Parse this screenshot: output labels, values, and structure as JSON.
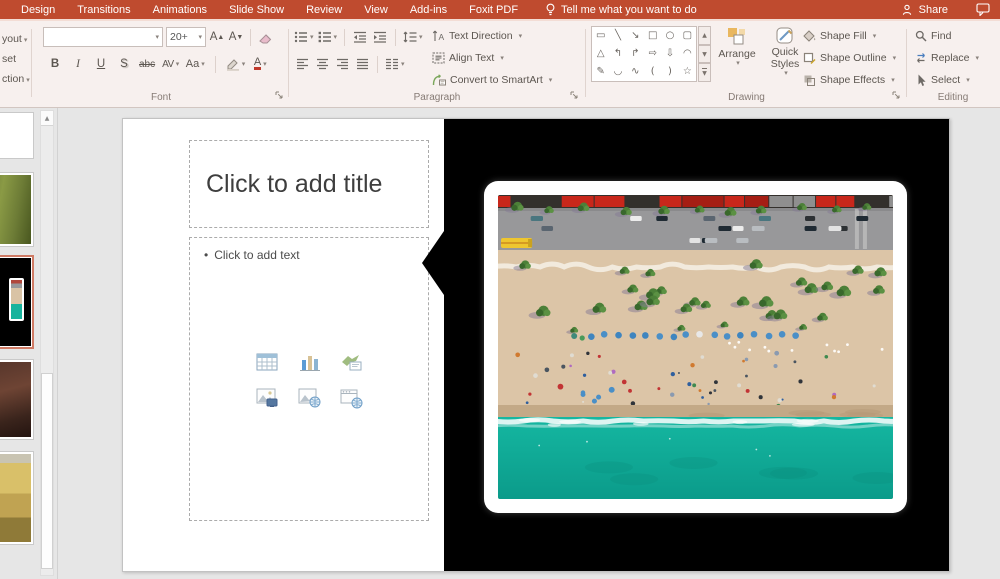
{
  "colors": {
    "accent_red": "#bf4b2f",
    "ribbon_bg": "#f7f0ee",
    "workspace_bg": "#e6e6e6",
    "selected_thumbnail_border": "#cf7a64",
    "arrange_orange": "#e9b75f"
  },
  "tab_bar": {
    "tabs": [
      "Design",
      "Transitions",
      "Animations",
      "Slide Show",
      "Review",
      "View",
      "Add-ins",
      "Foxit PDF"
    ],
    "tell_me_label": "Tell me what you want to do",
    "share_label": "Share"
  },
  "ribbon": {
    "slides_group_cut": {
      "layout_partial": "yout",
      "reset_partial": "set",
      "section_partial": "ction"
    },
    "font_group": {
      "label": "Font",
      "font_name_value": "",
      "font_size_value": "20+",
      "bold": "B",
      "italic": "I",
      "underline": "U",
      "shadow": "S",
      "strikethrough": "abc",
      "char_spacing": "AV",
      "change_case": "Aa",
      "font_color": "A"
    },
    "paragraph_group": {
      "label": "Paragraph",
      "text_direction_label": "Text Direction",
      "align_text_label": "Align Text",
      "convert_smartart_label": "Convert to SmartArt"
    },
    "drawing_group": {
      "label": "Drawing",
      "arrange_label": "Arrange",
      "quick_styles_label": "Quick Styles",
      "shape_fill_label": "Shape Fill",
      "shape_outline_label": "Shape Outline",
      "shape_effects_label": "Shape Effects",
      "shape_gallery_rows": [
        [
          "▭",
          "╲",
          "↘",
          "□",
          "○",
          "▢"
        ],
        [
          "△",
          "↰",
          "↱",
          "⇨",
          "⇩",
          "◠"
        ],
        [
          "✎",
          "◡",
          "∿",
          "(",
          ")",
          "☆"
        ]
      ]
    },
    "editing_group": {
      "label": "Editing",
      "find_label": "Find",
      "replace_label": "Replace",
      "select_label": "Select"
    }
  },
  "slide": {
    "title_placeholder": "Click to add title",
    "body_placeholder": "Click to add text",
    "bullet_char": "•",
    "content_icons": [
      "insert-table",
      "insert-chart",
      "insert-smartart",
      "insert-pictures",
      "insert-online-pictures",
      "insert-video"
    ]
  },
  "thumbnail_panel": {
    "slides": [
      {
        "name": "slide-blank",
        "selected": false
      },
      {
        "name": "slide-green-landscape",
        "selected": false
      },
      {
        "name": "slide-beach-callout",
        "selected": true
      },
      {
        "name": "slide-dark-photo",
        "selected": false
      },
      {
        "name": "slide-golden-field",
        "selected": false
      }
    ]
  },
  "photo": {
    "description": "aerial beach: red-awning boulevard, road with cars and yellow bus, palm-lined promenade, sand with blue umbrellas and people, turquoise surf",
    "palette": {
      "sand": "#dcc5a7",
      "road": "#98989a",
      "awning_red": "#c8271b",
      "awning_dark": "#33302c",
      "bus_yellow": "#eec62f",
      "palm_green": "#4c8038",
      "palm_shadow": "#837a93",
      "path_white": "#f2ecdf",
      "umbrella_blue": "#4a8fc7",
      "wet_sand": "#c3a987",
      "sea_light": "#15b7a1",
      "sea_dark": "#0b9b8a",
      "surf": "#ffffff"
    }
  }
}
